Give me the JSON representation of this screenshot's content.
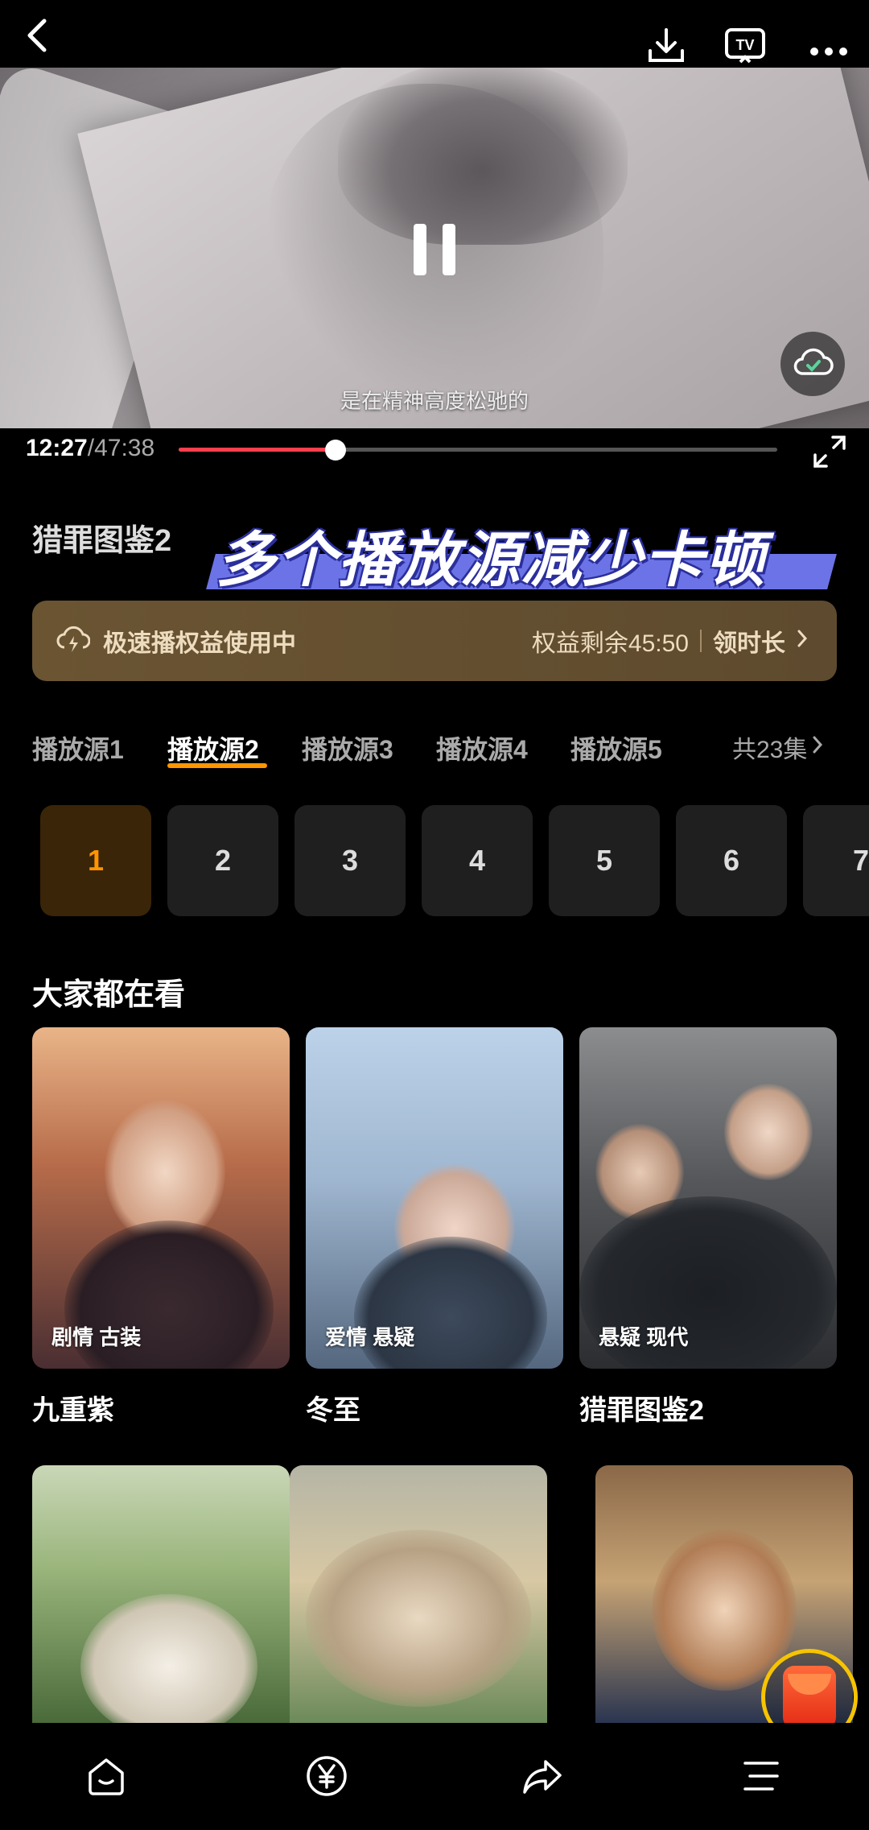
{
  "video": {
    "subtitle": "是在精神高度松驰的",
    "current_time": "12:27",
    "duration": "/47:38",
    "progress": 0.2615
  },
  "show": {
    "title": "猎罪图鉴2",
    "promo_banner": "多个播放源减少卡顿"
  },
  "perk": {
    "label": "极速播权益使用中",
    "remaining": "权益剩余45:50",
    "claim": "领时长"
  },
  "sources": {
    "tabs": [
      "播放源1",
      "播放源2",
      "播放源3",
      "播放源4",
      "播放源5"
    ],
    "active_index": 1,
    "total": "共23集"
  },
  "episodes": {
    "items": [
      "1",
      "2",
      "3",
      "4",
      "5",
      "6",
      "7"
    ],
    "active_index": 0
  },
  "recommend": {
    "title": "大家都在看",
    "cards": [
      {
        "tag": "剧情 古装",
        "name": "九重紫"
      },
      {
        "tag": "爱情 悬疑",
        "name": "冬至"
      },
      {
        "tag": "悬疑 现代",
        "name": "猎罪图鉴2"
      }
    ]
  },
  "colors": {
    "accent": "#ff9500",
    "progress": "#ff3e4d",
    "perk_bg": "#6a5432",
    "banner_blue": "#6c73e6"
  },
  "icons": {
    "top": [
      "back-icon",
      "download-icon",
      "tv-cast-icon",
      "more-icon"
    ],
    "bottom": [
      "home-icon",
      "yuan-icon",
      "share-icon",
      "menu-icon"
    ]
  }
}
